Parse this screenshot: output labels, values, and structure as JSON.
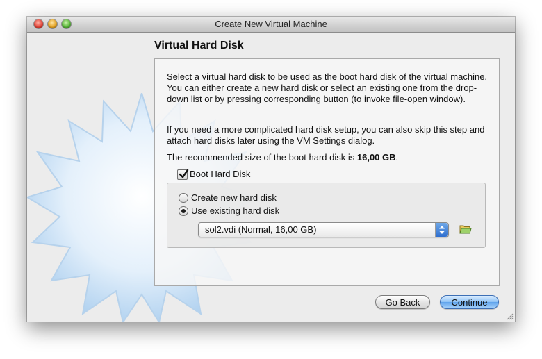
{
  "window": {
    "title": "Create New Virtual Machine"
  },
  "page": {
    "title": "Virtual Hard Disk",
    "description_1": "Select a virtual hard disk to be used as the boot hard disk of the virtual machine. You can either create a new hard disk or select an existing one from the drop-down list or by pressing corresponding button (to invoke file-open window).",
    "description_2": "If you need a more complicated hard disk setup, you can also skip this step and attach hard disks later using the VM Settings dialog.",
    "recommended_prefix": "The recommended size of the boot hard disk is ",
    "recommended_size": "16,00 GB",
    "recommended_suffix": "."
  },
  "boot_disk": {
    "label": "Boot Hard Disk",
    "checked": true
  },
  "options": {
    "create_new": {
      "label": "Create new hard disk",
      "selected": false
    },
    "use_existing": {
      "label": "Use existing hard disk",
      "selected": true
    }
  },
  "disk_select": {
    "value": "sol2.vdi (Normal, 16,00 GB)"
  },
  "buttons": {
    "back": "Go Back",
    "continue": "Continue"
  },
  "icons": {
    "close": "close-icon",
    "minimize": "minimize-icon",
    "zoom": "zoom-icon",
    "folder": "folder-open-icon",
    "watermark": "virtualbox-star-watermark-icon",
    "resize": "resize-grip-icon"
  },
  "colors": {
    "default_button": "#6aaaf0",
    "window_bg": "#ececec"
  }
}
